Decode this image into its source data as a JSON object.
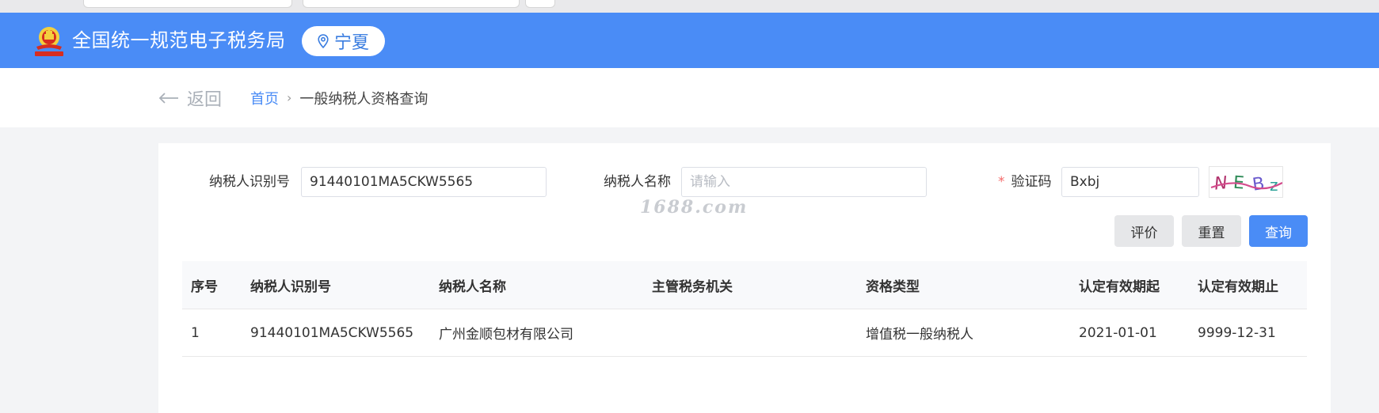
{
  "header": {
    "site_title": "全国统一规范电子税务局",
    "region": "宁夏",
    "region_icon": "location-pin-icon",
    "brand_color": "#4a8cf6"
  },
  "nav": {
    "back_label": "返回",
    "breadcrumb_home": "首页",
    "breadcrumb_current": "一般纳税人资格查询"
  },
  "form": {
    "taxpayer_id_label": "纳税人识别号",
    "taxpayer_id_value": "91440101MA5CKW5565",
    "taxpayer_name_label": "纳税人名称",
    "taxpayer_name_placeholder": "请输入",
    "captcha_label": "验证码",
    "captcha_required_mark": "*",
    "captcha_value": "Bxbj",
    "captcha_image_text": "NEBz"
  },
  "buttons": {
    "evaluate": "评价",
    "reset": "重置",
    "query": "查询"
  },
  "watermark": "1688.com",
  "table": {
    "columns": [
      "序号",
      "纳税人识别号",
      "纳税人名称",
      "主管税务机关",
      "资格类型",
      "认定有效期起",
      "认定有效期止"
    ],
    "rows": [
      [
        "1",
        "91440101MA5CKW5565",
        "广州金顺包材有限公司",
        "",
        "增值税一般纳税人",
        "2021-01-01",
        "9999-12-31"
      ]
    ]
  }
}
